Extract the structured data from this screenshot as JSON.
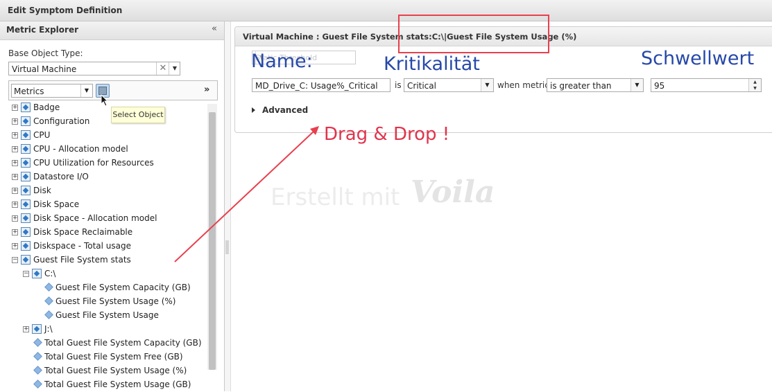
{
  "window": {
    "title": "Edit Symptom Definition"
  },
  "explorer": {
    "title": "Metric Explorer",
    "collapse_glyph": "«",
    "base_object_label": "Base Object Type:",
    "base_object_value": "Virtual Machine",
    "clear_glyph": "✕",
    "metrics_value": "Metrics",
    "more_glyph": "»",
    "tooltip": "Select Object",
    "tree": [
      {
        "label": "Badge"
      },
      {
        "label": "Configuration"
      },
      {
        "label": "CPU"
      },
      {
        "label": "CPU - Allocation model"
      },
      {
        "label": "CPU Utilization for Resources"
      },
      {
        "label": "Datastore I/O"
      },
      {
        "label": "Disk"
      },
      {
        "label": "Disk Space"
      },
      {
        "label": "Disk Space - Allocation model"
      },
      {
        "label": "Disk Space Reclaimable"
      },
      {
        "label": "Diskspace - Total usage"
      },
      {
        "label": "Guest File System stats"
      },
      {
        "label": "C:\\"
      },
      {
        "label": "Guest File System Capacity (GB)"
      },
      {
        "label": "Guest File System Usage (%)"
      },
      {
        "label": "Guest File System Usage"
      },
      {
        "label": "J:\\"
      },
      {
        "label": "Total Guest File System Capacity (GB)"
      },
      {
        "label": "Total Guest File System Free (GB)"
      },
      {
        "label": "Total Guest File System Usage (%)"
      },
      {
        "label": "Total Guest File System Usage (GB)"
      }
    ]
  },
  "symptom": {
    "header": "Virtual Machine : Guest File System stats:C:\\|Guest File System Usage (%)",
    "threshold_type": "Static Threshold",
    "name_value": "MD_Drive_C: Usage%_Critical",
    "is_label": "is",
    "criticality_value": "Critical",
    "when_metric_label": "when metric",
    "operator_value": "is greater than",
    "threshold_value": "95",
    "advanced_label": "Advanced"
  },
  "annotations": {
    "name": "Name:",
    "criticality": "Kritikalität",
    "threshold": "Schwellwert",
    "drag_drop": "Drag & Drop !",
    "watermark_text": "Erstellt mit",
    "watermark_logo": "Voila"
  },
  "colors": {
    "annotation_blue": "#2648a8",
    "annotation_red": "#e0344c"
  }
}
